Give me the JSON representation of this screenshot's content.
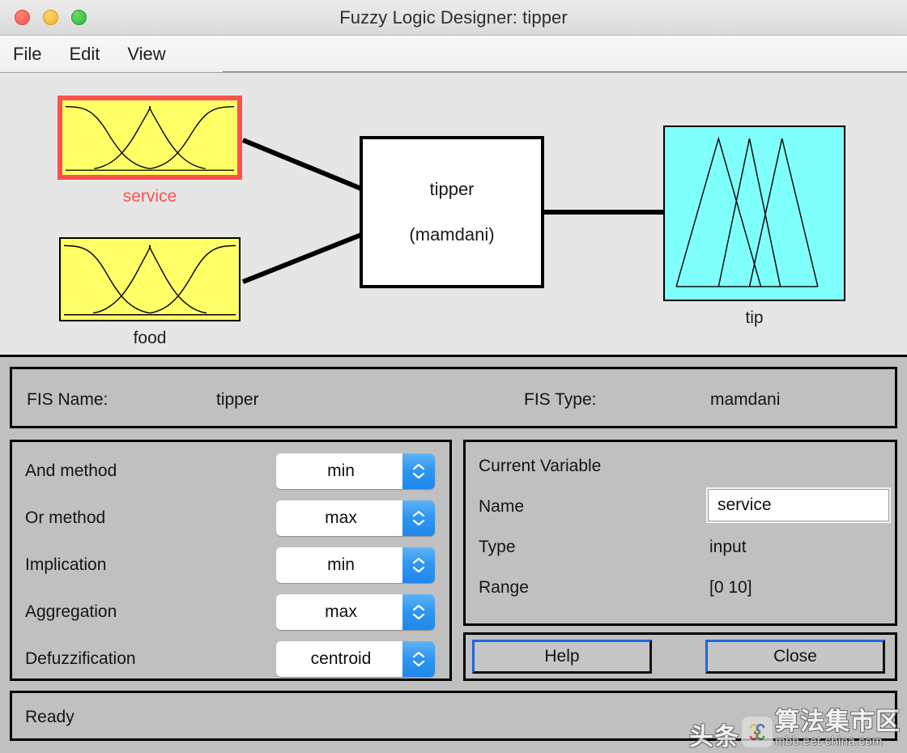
{
  "window": {
    "title": "Fuzzy Logic Designer: tipper",
    "traffic_lights": [
      {
        "name": "close-button",
        "color": "#f4564c"
      },
      {
        "name": "minimize-button",
        "color": "#f5b325"
      },
      {
        "name": "zoom-button",
        "color": "#25b935"
      }
    ]
  },
  "menubar": {
    "items": [
      {
        "label": "File"
      },
      {
        "label": "Edit"
      },
      {
        "label": "View"
      }
    ]
  },
  "diagram": {
    "inputs": [
      {
        "label": "service",
        "selected": true,
        "mf_shape": "gaussian",
        "mf_count": 3,
        "fill": "#ffff66",
        "border": "#f9524f"
      },
      {
        "label": "food",
        "selected": false,
        "mf_shape": "gaussian",
        "mf_count": 3,
        "fill": "#ffff66",
        "border": "#000000"
      }
    ],
    "system": {
      "name": "tipper",
      "type_label": "(mamdani)"
    },
    "outputs": [
      {
        "label": "tip",
        "selected": false,
        "mf_shape": "triangular",
        "mf_count": 3,
        "fill": "#7ffffb",
        "border": "#000000"
      }
    ]
  },
  "fis_summary": {
    "name_label": "FIS Name:",
    "name_value": "tipper",
    "type_label": "FIS Type:",
    "type_value": "mamdani"
  },
  "methods": [
    {
      "label": "And method",
      "value": "min"
    },
    {
      "label": "Or method",
      "value": "max"
    },
    {
      "label": "Implication",
      "value": "min"
    },
    {
      "label": "Aggregation",
      "value": "max"
    },
    {
      "label": "Defuzzification",
      "value": "centroid"
    }
  ],
  "current_variable": {
    "heading": "Current Variable",
    "name_label": "Name",
    "name_value": "service",
    "type_label": "Type",
    "type_value": "input",
    "range_label": "Range",
    "range_value": "[0 10]"
  },
  "buttons": {
    "help": "Help",
    "close": "Close"
  },
  "status": {
    "text": "Ready"
  },
  "watermark": {
    "text_left": "头条",
    "text_right": "算法集市区",
    "url": "mbb.eet-china.com"
  }
}
